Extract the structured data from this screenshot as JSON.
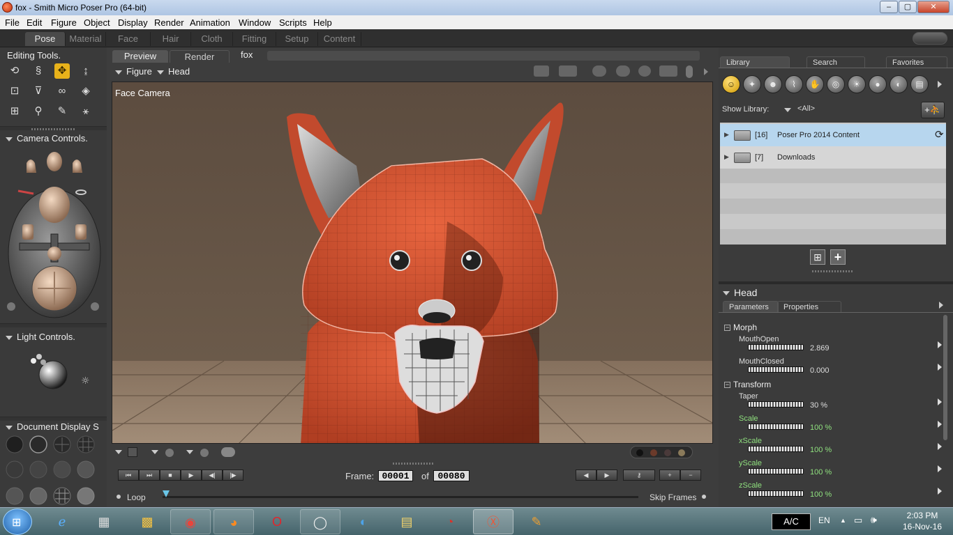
{
  "window": {
    "title": "fox - Smith Micro Poser Pro  (64-bit)",
    "minimize_glyph": "–",
    "maximize_glyph": "▢",
    "close_glyph": "✕"
  },
  "menu": [
    "File",
    "Edit",
    "Figure",
    "Object",
    "Display",
    "Render",
    "Animation",
    "Window",
    "Scripts",
    "Help"
  ],
  "rooms": [
    "Pose",
    "Material",
    "Face",
    "Hair",
    "Cloth",
    "Fitting",
    "Setup",
    "Content"
  ],
  "left": {
    "editing_tools_title": "Editing Tools.",
    "camera_controls_title": "Camera Controls.",
    "light_controls_title": "Light Controls.",
    "document_display_title": "Document Display S"
  },
  "viewport": {
    "tabs": [
      "Preview",
      "Render"
    ],
    "document_name": "fox",
    "figure_menu": "Figure",
    "actor_menu": "Head",
    "camera_label": "Face Camera"
  },
  "timeline": {
    "frame_label": "Frame:",
    "current_frame": "00001",
    "of_label": "of",
    "total_frames": "00080",
    "loop_label": "Loop",
    "skip_frames_label": "Skip Frames"
  },
  "library": {
    "tabs": [
      "Library",
      "Search",
      "Favorites"
    ],
    "show_library_label": "Show Library:",
    "show_library_value": "<All>",
    "folders": [
      {
        "count": "[16]",
        "name": "Poser Pro 2014 Content"
      },
      {
        "count": "[7]",
        "name": "Downloads"
      }
    ]
  },
  "parameters": {
    "actor_title": "Head",
    "tabs": [
      "Parameters",
      "Properties"
    ],
    "sections": [
      {
        "name": "Morph",
        "items": [
          {
            "name": "MouthOpen",
            "value": "2.869"
          },
          {
            "name": "MouthClosed",
            "value": "0.000"
          }
        ]
      },
      {
        "name": "Transform",
        "items": [
          {
            "name": "Taper",
            "value": "30 %"
          },
          {
            "name": "Scale",
            "value": "100 %"
          },
          {
            "name": "xScale",
            "value": "100 %"
          },
          {
            "name": "yScale",
            "value": "100 %"
          },
          {
            "name": "zScale",
            "value": "100 %"
          }
        ]
      }
    ]
  },
  "taskbar": {
    "ac_label": "A/C",
    "language": "EN",
    "time": "2:03 PM",
    "date": "16-Nov-16"
  },
  "colors": {
    "accent": "#e8b21a",
    "selected_row": "#b7d6ee",
    "fox_fur": "#d8573a",
    "param_green": "#8fe07e"
  }
}
